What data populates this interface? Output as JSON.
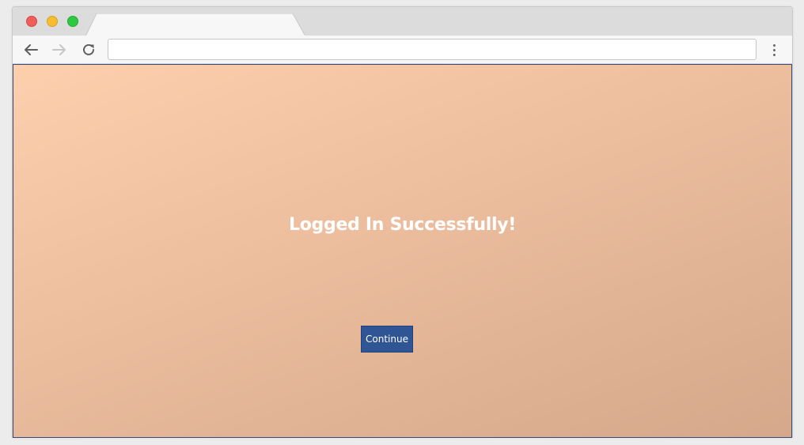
{
  "browser": {
    "traffic_lights": {
      "close_color": "#ee5f5a",
      "minimize_color": "#f5bd2f",
      "maximize_color": "#2fc841"
    },
    "tab": {
      "title": ""
    },
    "address_bar": {
      "value": "",
      "placeholder": ""
    },
    "icons": {
      "back": "arrow-left-icon",
      "forward": "arrow-right-icon",
      "reload": "reload-icon",
      "menu": "vertical-ellipsis-icon"
    }
  },
  "page": {
    "background_gradient": [
      "#fecfad",
      "#d5a88b"
    ],
    "headline": "Logged In Successfully!",
    "continue_label": "Continue",
    "button_color": "#2f5595"
  }
}
